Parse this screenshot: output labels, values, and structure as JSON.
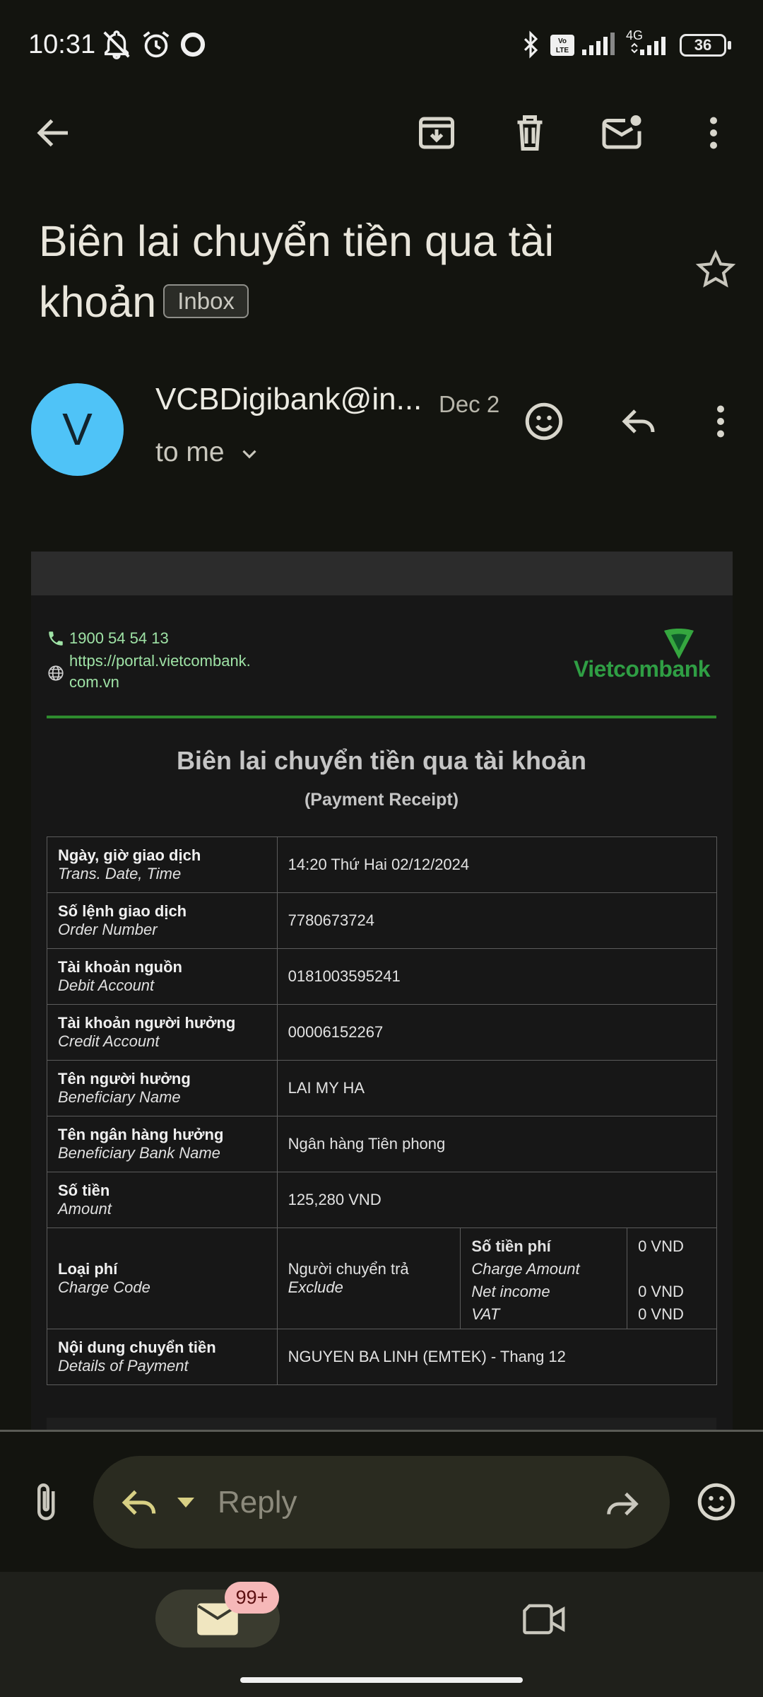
{
  "status_bar": {
    "time": "10:31",
    "battery": "36",
    "network": "4G"
  },
  "email": {
    "subject": "Biên lai chuyển tiền qua tài khoản",
    "label": "Inbox",
    "sender_initial": "V",
    "sender": "VCBDigibank@in...",
    "date": "Dec 2",
    "recipient": "to me"
  },
  "receipt": {
    "phone": "1900 54 54 13",
    "website_line1": "https://portal.vietcombank.",
    "website_line2": "com.vn",
    "logo_text": "Vietcombank",
    "title": "Biên lai chuyển tiền qua tài khoản",
    "subtitle": "(Payment Receipt)",
    "rows": [
      {
        "label_vi": "Ngày, giờ giao dịch",
        "label_en": "Trans. Date, Time",
        "value": "14:20 Thứ Hai 02/12/2024"
      },
      {
        "label_vi": "Số lệnh giao dịch",
        "label_en": "Order Number",
        "value": "7780673724"
      },
      {
        "label_vi": "Tài khoản nguồn",
        "label_en": "Debit Account",
        "value": "0181003595241"
      },
      {
        "label_vi": "Tài khoản người hưởng",
        "label_en": "Credit Account",
        "value": "00006152267"
      },
      {
        "label_vi": "Tên người hưởng",
        "label_en": "Beneficiary Name",
        "value": "LAI MY HA"
      },
      {
        "label_vi": "Tên ngân hàng hưởng",
        "label_en": "Beneficiary Bank Name",
        "value": "Ngân hàng Tiên phong"
      },
      {
        "label_vi": "Số tiền",
        "label_en": "Amount",
        "value": "125,280 VND"
      }
    ],
    "charge": {
      "label_vi": "Loại phí",
      "label_en": "Charge Code",
      "value_vi": "Người chuyển trả",
      "value_en": "Exclude",
      "fee_label_vi": "Số tiền phí",
      "fee_label_en": "Charge Amount",
      "net_label": "Net income",
      "vat_label": "VAT",
      "fee_value": "0 VND",
      "net_value": "0 VND",
      "vat_value": "0 VND"
    },
    "details": {
      "label_vi": "Nội dung chuyển tiền",
      "label_en": "Details of Payment",
      "value": "NGUYEN BA LINH (EMTEK) - Thang 12"
    }
  },
  "reply_bar": {
    "placeholder": "Reply"
  },
  "bottom_nav": {
    "mail_badge": "99+"
  }
}
